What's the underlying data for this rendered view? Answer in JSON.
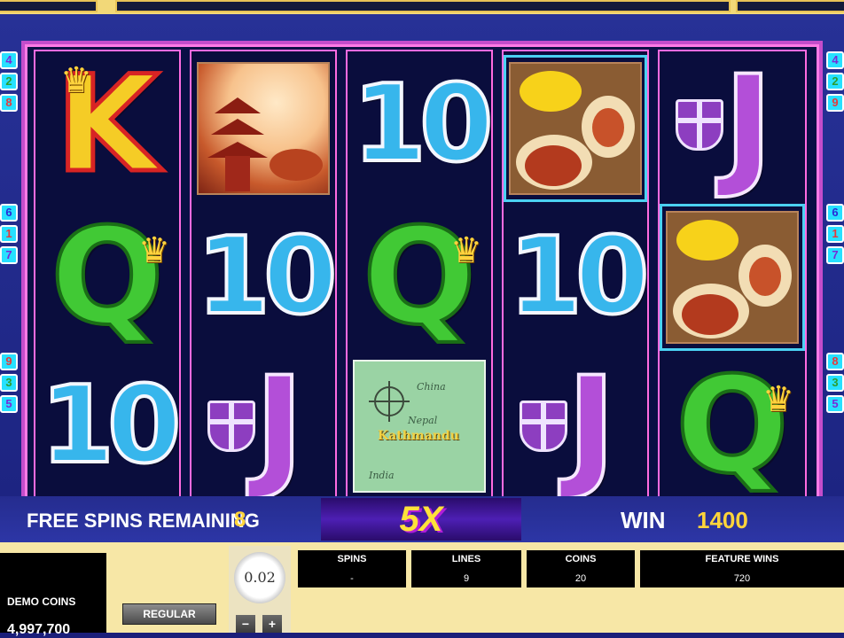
{
  "game": {
    "free_spins_label": "FREE SPINS REMAINING",
    "free_spins_value": "8",
    "multiplier": "5X",
    "win_label": "WIN",
    "win_value": "1400"
  },
  "reels": [
    [
      "K",
      "pagoda",
      "Q",
      "10"
    ],
    [
      "10",
      "J"
    ],
    [
      "10",
      "Q",
      "map"
    ],
    [
      "spices",
      "10",
      "J"
    ],
    [
      "J",
      "spices",
      "Q"
    ]
  ],
  "map_labels": {
    "country1": "China",
    "country2": "Nepal",
    "capital": "Kathmandu",
    "country3": "India"
  },
  "paylines": {
    "left": [
      "4",
      "2",
      "8",
      "6",
      "1",
      "7",
      "9",
      "3",
      "5"
    ],
    "right": [
      "4",
      "2",
      "9",
      "6",
      "1",
      "7",
      "8",
      "3",
      "5"
    ],
    "colors": [
      "#e63a3a",
      "#2e9c2e",
      "#2a2ad6",
      "#7a2ad6"
    ]
  },
  "controls": {
    "demo_label": "DEMO COINS",
    "demo_value": "4,997,700",
    "regular_label": "REGULAR",
    "coin_value": "0.02",
    "minus": "−",
    "plus": "+"
  },
  "stats": [
    {
      "header": "SPINS",
      "value": "-"
    },
    {
      "header": "LINES",
      "value": "9"
    },
    {
      "header": "COINS",
      "value": "20"
    },
    {
      "header": "FEATURE WINS",
      "value": "720"
    }
  ],
  "icons": [
    "crown-icon",
    "shield-icon",
    "target-icon"
  ]
}
